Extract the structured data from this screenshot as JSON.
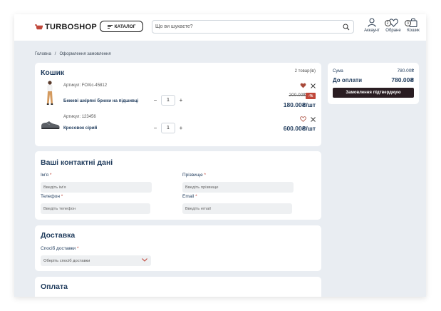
{
  "header": {
    "logo": "TURBOSHOP",
    "catalog_label": "КАТАЛОГ",
    "search_placeholder": "Що ви шукаєте?",
    "account_label": "Аккаунт",
    "favorites_label": "Обране",
    "favorites_count": "2",
    "cart_label": "Кошик",
    "cart_count": "3"
  },
  "breadcrumb": {
    "home": "Головна",
    "separator": "/",
    "current": "Оформлення замовлення"
  },
  "cart": {
    "title": "Кошик",
    "count_text": "2 товар(ів)",
    "items": [
      {
        "sku": "Артикул: FOXic-45812",
        "name": "Бежеві шкіряні брюки на підшивці",
        "qty": "1",
        "minus": "−",
        "plus": "+",
        "old_price": "200.00₴",
        "discount": "-%",
        "price": "180.00₴/шт",
        "favorite": true
      },
      {
        "sku": "Артикул: 123456",
        "name": "Кросовок сірий",
        "qty": "1",
        "minus": "−",
        "plus": "+",
        "price": "600.00₴/шт",
        "favorite": false
      }
    ]
  },
  "summary": {
    "sum_label": "Сума",
    "sum_value": "780.00₴",
    "pay_label": "До оплати",
    "pay_value": "780.00₴",
    "confirm_label": "Замовлення підтверджую"
  },
  "contacts": {
    "title": "Ваші контактні дані",
    "name_label": "Ім'я",
    "name_placeholder": "Введіть ім'я",
    "surname_label": "Прізвище",
    "surname_placeholder": "Введіть прізвище",
    "phone_label": "Телефон",
    "phone_placeholder": "Введіть телефон",
    "email_label": "Email",
    "email_placeholder": "Введіть email",
    "required_mark": "*"
  },
  "delivery": {
    "title": "Доставка",
    "method_label": "Спосіб доставки",
    "method_placeholder": "Оберіть спосіб доставки"
  },
  "payment": {
    "title": "Оплата"
  },
  "colors": {
    "brand": "#c0473a",
    "text_dark_blue": "#1f3b5c",
    "confirm_bg": "#2a1d22",
    "page_bg": "#e9edf2"
  }
}
